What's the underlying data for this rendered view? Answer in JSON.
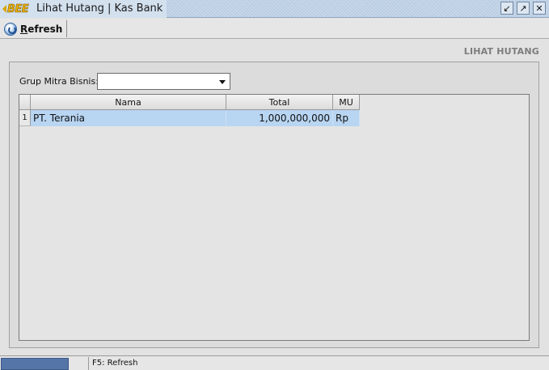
{
  "window": {
    "logo": "BEE",
    "title": "Lihat Hutang | Kas Bank",
    "buttons": {
      "restore": "↙",
      "maximize": "↗",
      "close": "✕"
    }
  },
  "toolbar": {
    "refresh_hotkey": "R",
    "refresh_rest": "efresh"
  },
  "section_title": "LIHAT HUTANG",
  "filter": {
    "label": "Grup Mitra Bisnis:",
    "value": ""
  },
  "table": {
    "columns": [
      "Nama",
      "Total",
      "MU"
    ],
    "rows": [
      {
        "num": "1",
        "nama": "PT. Terania",
        "total": "1,000,000,000",
        "mu": "Rp"
      }
    ]
  },
  "status": {
    "progress": 1.0,
    "text": "F5: Refresh"
  },
  "colors": {
    "titlebar": "#c9d9ea",
    "selected_row": "#b8d5f2",
    "progress": "#5574a8"
  }
}
